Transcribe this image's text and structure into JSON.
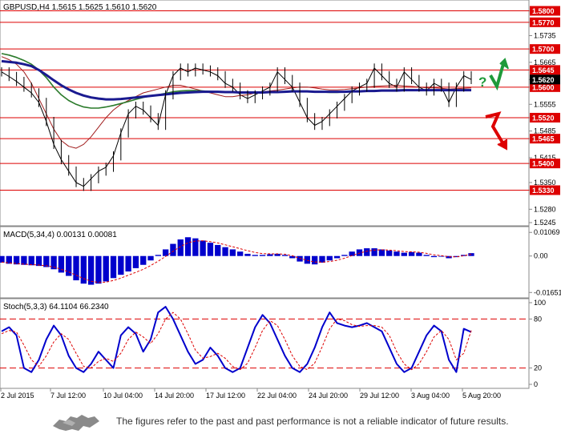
{
  "colors": {
    "price": "#000000",
    "level_line": "#dd0000",
    "level_label_bg": "#dd0000",
    "current_label_bg": "#000000",
    "ma_red": "#a01c1c",
    "ma_green": "#2a7a2a",
    "ma_blue": "#1a1a90",
    "macd_hist": "#0000cc",
    "macd_signal": "#dd0000",
    "stoch_main": "#0000cc",
    "stoch_signal": "#dd0000",
    "arrow_up": "#1f9a3a",
    "arrow_down": "#dd0000",
    "axis_text": "#000000"
  },
  "chart_data": [
    {
      "type": "line",
      "title": "GBPUSD,H4  1.5615 1.5625 1.5610 1.5620",
      "ylim": [
        1.5245,
        1.582
      ],
      "y_ticks": [
        "1.5800",
        "1.5770",
        "1.5735",
        "1.5700",
        "1.5665",
        "1.5645",
        "1.5620",
        "1.5600",
        "1.5555",
        "1.5520",
        "1.5485",
        "1.5465",
        "1.5415",
        "1.5400",
        "1.5350",
        "1.5330",
        "1.5280",
        "1.5245"
      ],
      "levels": [
        1.58,
        1.577,
        1.57,
        1.5645,
        1.56,
        1.552,
        1.5465,
        1.54,
        1.533
      ],
      "level_labels": [
        "1.5800",
        "1.5770",
        "1.5700",
        "1.5645",
        "1.5600",
        "1.5520",
        "1.5465",
        "1.5400",
        "1.5330"
      ],
      "current_price": 1.562,
      "current_label": "1.5620",
      "x_labels": [
        "2 Jul 2015",
        "7 Jul 12:00",
        "10 Jul 04:00",
        "14 Jul 20:00",
        "17 Jul 12:00",
        "22 Jul 04:00",
        "24 Jul 20:00",
        "29 Jul 12:00",
        "3 Aug 04:00",
        "5 Aug 20:00"
      ],
      "series": [
        {
          "values": [
            1.564,
            1.5628,
            1.5615,
            1.56,
            1.5585,
            1.556,
            1.551,
            1.545,
            1.541,
            1.538,
            1.535,
            1.534,
            1.536,
            1.538,
            1.539,
            1.542,
            1.548,
            1.553,
            1.555,
            1.554,
            1.552,
            1.55,
            1.558,
            1.563,
            1.565,
            1.564,
            1.565,
            1.5645,
            1.564,
            1.563,
            1.561,
            1.56,
            1.558,
            1.557,
            1.558,
            1.559,
            1.56,
            1.564,
            1.562,
            1.56,
            1.556,
            1.552,
            1.55,
            1.551,
            1.553,
            1.555,
            1.557,
            1.559,
            1.56,
            1.561,
            1.565,
            1.563,
            1.561,
            1.56,
            1.564,
            1.562,
            1.56,
            1.559,
            1.561,
            1.56,
            1.556,
            1.56,
            1.563,
            1.562
          ]
        },
        {
          "name": "",
          "values": [
            1.568,
            1.5672,
            1.566,
            1.564,
            1.561,
            1.557,
            1.553,
            1.549,
            1.546,
            1.5445,
            1.544,
            1.545,
            1.547,
            1.5495,
            1.552,
            1.554,
            1.5555,
            1.5565,
            1.5575,
            1.5585,
            1.559,
            1.5595,
            1.56,
            1.5605,
            1.5605,
            1.56,
            1.5595,
            1.559,
            1.5585,
            1.558,
            1.5575,
            1.5575,
            1.5578,
            1.558,
            1.5585,
            1.5588,
            1.559,
            1.5592,
            1.5595,
            1.5598,
            1.56,
            1.56,
            1.5598,
            1.5595,
            1.5593,
            1.5593,
            1.5594,
            1.5596,
            1.5598,
            1.56,
            1.5602,
            1.5603,
            1.5604,
            1.5605,
            1.5603,
            1.5602,
            1.56,
            1.5598,
            1.5598,
            1.5597,
            1.5595,
            1.5596,
            1.5597,
            1.5598
          ]
        },
        {
          "name": "",
          "values": [
            1.5688,
            1.5684,
            1.5678,
            1.567,
            1.566,
            1.5645,
            1.5625,
            1.56,
            1.558,
            1.5565,
            1.5555,
            1.5548,
            1.5545,
            1.5545,
            1.5548,
            1.5552,
            1.5557,
            1.5562,
            1.5568,
            1.5573,
            1.5577,
            1.558,
            1.5584,
            1.5588,
            1.559,
            1.5591,
            1.5591,
            1.559,
            1.5589,
            1.5588,
            1.5587,
            1.5586,
            1.5585,
            1.5585,
            1.5585,
            1.5586,
            1.5587,
            1.5588,
            1.5589,
            1.559,
            1.559,
            1.5589,
            1.5588,
            1.5587,
            1.5586,
            1.5586,
            1.5587,
            1.5588,
            1.5589,
            1.559,
            1.5591,
            1.5592,
            1.5592,
            1.5593,
            1.5593,
            1.5593,
            1.5592,
            1.5592,
            1.5592,
            1.5592,
            1.5592,
            1.5592,
            1.5593,
            1.5593
          ]
        },
        {
          "name": "",
          "values": [
            1.5668,
            1.5666,
            1.5664,
            1.566,
            1.5655,
            1.5645,
            1.5632,
            1.5618,
            1.5605,
            1.5594,
            1.5585,
            1.5578,
            1.5573,
            1.557,
            1.5568,
            1.5568,
            1.5569,
            1.5571,
            1.5573,
            1.5575,
            1.5577,
            1.5579,
            1.5581,
            1.5583,
            1.5585,
            1.5586,
            1.5587,
            1.5588,
            1.5588,
            1.5588,
            1.5587,
            1.5587,
            1.5586,
            1.5586,
            1.5586,
            1.5586,
            1.5587,
            1.5587,
            1.5588,
            1.5589,
            1.5589,
            1.5589,
            1.5588,
            1.5588,
            1.5588,
            1.5588,
            1.5588,
            1.5589,
            1.5589,
            1.559,
            1.559,
            1.5591,
            1.5591,
            1.5591,
            1.5592,
            1.5592,
            1.5592,
            1.5592,
            1.5592,
            1.5592,
            1.5592,
            1.5592,
            1.5592,
            1.5592
          ]
        }
      ]
    },
    {
      "type": "bar",
      "title": "MACD(5,34,4) 0.00131 0.00081",
      "ylim": [
        -0.0175,
        0.0115
      ],
      "y_ticks": [
        "0.01069",
        "0.00",
        "-0.01651"
      ],
      "series": [
        {
          "name": "",
          "values": [
            -0.003,
            -0.0035,
            -0.0038,
            -0.004,
            -0.0042,
            -0.0045,
            -0.005,
            -0.006,
            -0.0075,
            -0.009,
            -0.011,
            -0.0125,
            -0.013,
            -0.0125,
            -0.0115,
            -0.01,
            -0.0085,
            -0.007,
            -0.0055,
            -0.004,
            -0.002,
            0.0005,
            0.003,
            0.0055,
            0.0075,
            0.0085,
            0.008,
            0.007,
            0.006,
            0.005,
            0.004,
            0.003,
            0.002,
            0.001,
            0.0005,
            0.0005,
            0.0008,
            0.001,
            0.0005,
            -0.001,
            -0.0025,
            -0.0035,
            -0.0038,
            -0.003,
            -0.002,
            -0.001,
            0.0005,
            0.002,
            0.003,
            0.0035,
            0.0035,
            0.003,
            0.0025,
            0.002,
            0.0015,
            0.0018,
            0.0015,
            0.0005,
            -0.0005,
            -0.0003,
            -0.001,
            -0.0005,
            0.0005,
            0.0013
          ]
        },
        {
          "name": "",
          "values": [
            -0.0028,
            -0.0031,
            -0.0034,
            -0.0037,
            -0.0039,
            -0.0041,
            -0.0044,
            -0.005,
            -0.006,
            -0.0072,
            -0.0087,
            -0.0102,
            -0.0114,
            -0.012,
            -0.0118,
            -0.0111,
            -0.01,
            -0.0087,
            -0.0074,
            -0.006,
            -0.0043,
            -0.0024,
            -0.0002,
            0.0021,
            0.0043,
            0.006,
            0.0068,
            0.0069,
            0.0065,
            0.0059,
            0.0051,
            0.0042,
            0.0033,
            0.0024,
            0.0016,
            0.0011,
            0.001,
            0.001,
            0.0008,
            0.0001,
            -0.001,
            -0.002,
            -0.0027,
            -0.0028,
            -0.0025,
            -0.0019,
            -0.001,
            0.0002,
            0.0013,
            0.0022,
            0.0027,
            0.0028,
            0.0027,
            0.0024,
            0.002,
            0.0019,
            0.0017,
            0.0012,
            0.0005,
            0.0002,
            -0.0003,
            -0.0004,
            0.0001,
            0.0008
          ]
        }
      ]
    },
    {
      "type": "line",
      "title": "Stoch(5,3,3) 64.1104 66.2340",
      "ylim": [
        0,
        100
      ],
      "y_ticks": [
        "100",
        "80",
        "20",
        "0"
      ],
      "levels": [
        80,
        20
      ],
      "series": [
        {
          "name": "",
          "values": [
            65,
            70,
            60,
            20,
            15,
            30,
            55,
            72,
            60,
            35,
            20,
            15,
            25,
            40,
            30,
            20,
            60,
            70,
            62,
            40,
            55,
            88,
            95,
            80,
            60,
            40,
            25,
            30,
            45,
            35,
            20,
            15,
            20,
            45,
            70,
            85,
            75,
            55,
            35,
            20,
            15,
            25,
            45,
            70,
            88,
            75,
            72,
            70,
            72,
            75,
            70,
            65,
            45,
            25,
            15,
            20,
            40,
            60,
            72,
            65,
            30,
            15,
            68,
            64
          ]
        },
        {
          "name": "",
          "values": [
            62,
            66,
            64,
            48,
            30,
            22,
            35,
            52,
            62,
            55,
            38,
            22,
            20,
            28,
            32,
            28,
            38,
            55,
            64,
            58,
            50,
            62,
            80,
            88,
            80,
            62,
            42,
            32,
            34,
            38,
            32,
            22,
            18,
            26,
            45,
            66,
            78,
            72,
            55,
            35,
            22,
            18,
            26,
            46,
            68,
            80,
            78,
            73,
            71,
            72,
            72,
            70,
            60,
            40,
            25,
            18,
            25,
            40,
            58,
            66,
            55,
            30,
            38,
            66
          ]
        }
      ]
    }
  ],
  "disclaimer": "The figures refer to the past and past performance is not a reliable indicator of future results.",
  "annotations": {
    "question_mark": "?",
    "up_arrow_icon": "zigzag-up-arrow",
    "down_arrow_icon": "zigzag-down-arrow"
  }
}
